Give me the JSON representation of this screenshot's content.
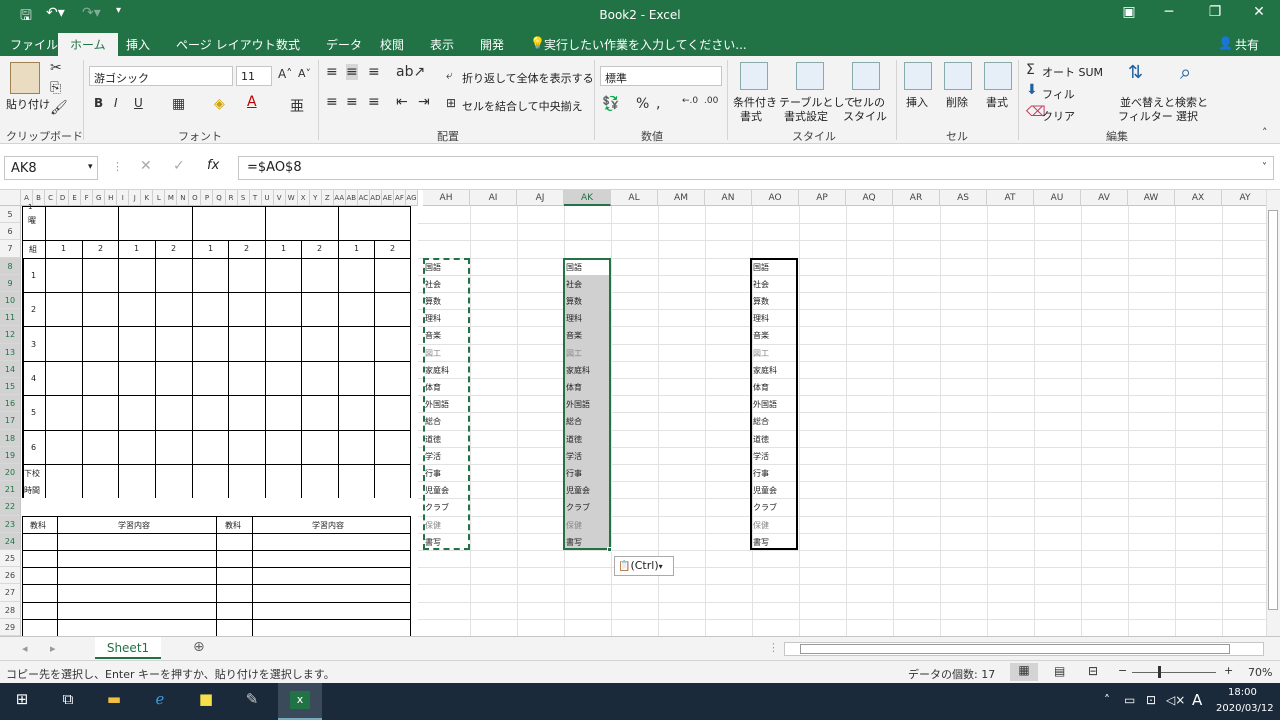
{
  "titlebar": {
    "title": "Book2 - Excel"
  },
  "tabs": [
    "ファイル",
    "ホーム",
    "挿入",
    "ページ レイアウト",
    "数式",
    "データ",
    "校閲",
    "表示",
    "開発"
  ],
  "tellme": "実行したい作業を入力してください...",
  "share": "共有",
  "ribbon": {
    "paste": "貼り付け",
    "clipboard": "クリップボード",
    "font_name": "游ゴシック",
    "font_size": "11",
    "font": "フォント",
    "wrap": "折り返して全体を表示する",
    "merge": "セルを結合して中央揃え",
    "align": "配置",
    "numfmt": "標準",
    "number": "数値",
    "cond1": "条件付き",
    "cond2": "書式",
    "table1": "テーブルとして",
    "table2": "書式設定",
    "cellstyle1": "セルの",
    "cellstyle2": "スタイル",
    "style": "スタイル",
    "insert": "挿入",
    "delete": "削除",
    "format": "書式",
    "cells": "セル",
    "autosum": "オート SUM",
    "fill": "フィル",
    "clear": "クリア",
    "sort1": "並べ替えと",
    "sort2": "フィルター",
    "find1": "検索と",
    "find2": "選択",
    "edit": "編集"
  },
  "namebox": "AK8",
  "formula": "=$AO$8",
  "cols_small": [
    "A",
    "B",
    "C",
    "D",
    "E",
    "F",
    "G",
    "H",
    "I",
    "J",
    "K",
    "L",
    "M",
    "N",
    "O",
    "P",
    "Q",
    "R",
    "S",
    "T",
    "U",
    "V",
    "W",
    "X",
    "Y",
    "Z",
    "AA",
    "AB",
    "AC",
    "AD",
    "AE",
    "AF",
    "AG"
  ],
  "cols": [
    "AH",
    "AI",
    "AJ",
    "AK",
    "AL",
    "AM",
    "AN",
    "AO",
    "AP",
    "AQ",
    "AR",
    "AS",
    "AT",
    "AU",
    "AV",
    "AW",
    "AX",
    "AY"
  ],
  "rows": [
    "5",
    "6",
    "7",
    "8",
    "9",
    "10",
    "11",
    "12",
    "13",
    "14",
    "15",
    "16",
    "17",
    "18",
    "19",
    "20",
    "21",
    "22",
    "23",
    "24",
    "25",
    "26",
    "27",
    "28",
    "29"
  ],
  "table": {
    "row5": "1",
    "row5b": "曜",
    "kumi_label": "組",
    "kumi": [
      "1",
      "2",
      "1",
      "2",
      "1",
      "2",
      "1",
      "2",
      "1",
      "2"
    ],
    "periods": [
      "1",
      "2",
      "3",
      "4",
      "5",
      "6"
    ],
    "gekou1": "下校",
    "gekou2": "時間",
    "kyoka": "教科",
    "naiyou": "学習内容"
  },
  "subjects": [
    "国語",
    "社会",
    "算数",
    "理科",
    "音楽",
    "図工",
    "家庭科",
    "体育",
    "外国語",
    "総合",
    "道徳",
    "学活",
    "行事",
    "児童会",
    "クラブ",
    "保健",
    "書写"
  ],
  "paste_tag": "(Ctrl)",
  "sheet_tab": "Sheet1",
  "status": {
    "left": "コピー先を選択し、Enter キーを押すか、貼り付けを選択します。",
    "count": "データの個数: 17",
    "zoom": "70%"
  },
  "taskbar": {
    "time": "18:00",
    "date": "2020/03/12",
    "ime": "A"
  }
}
